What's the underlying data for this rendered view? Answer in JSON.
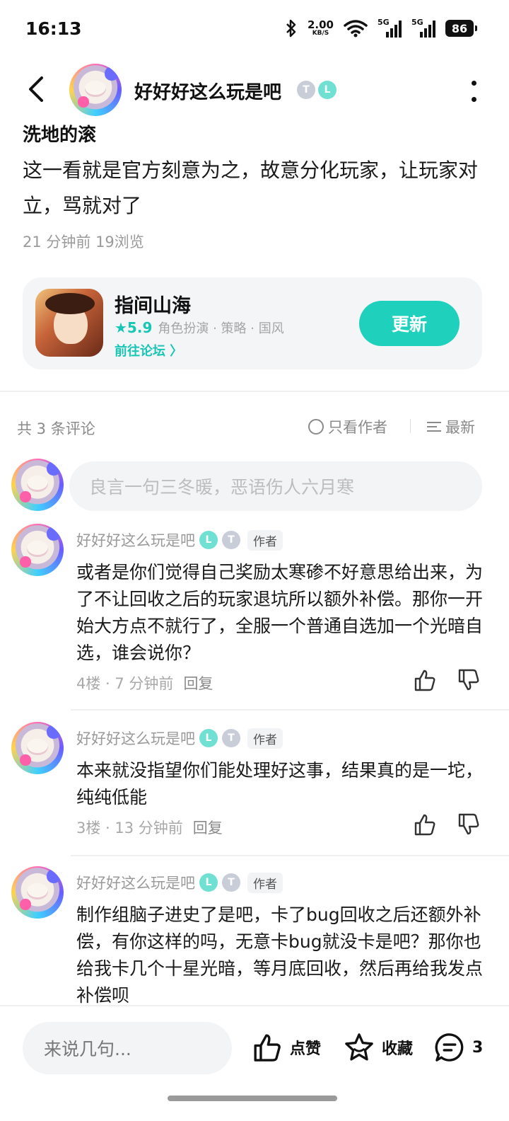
{
  "status_bar": {
    "time": "16:13",
    "net_speed_value": "2.00",
    "net_speed_unit": "KB/S",
    "signal_1": "5G",
    "signal_2": "5G",
    "battery": "86"
  },
  "header": {
    "username": "好好好这么玩是吧",
    "badges": [
      "T",
      "L"
    ]
  },
  "post": {
    "title": "洗地的滚",
    "body": "这一看就是官方刻意为之，故意分化玩家，让玩家对立，骂就对了",
    "meta": "21 分钟前  19浏览"
  },
  "game_card": {
    "name": "指间山海",
    "score": "★5.9",
    "tags": "角色扮演 · 策略 · 国风",
    "forum_link": "前往论坛 〉",
    "update_label": "更新"
  },
  "comments_bar": {
    "count": "共 3 条评论",
    "only_author": "只看作者",
    "sort": "最新",
    "input_placeholder": "良言一句三冬暖，恶语伤人六月寒"
  },
  "comments": [
    {
      "name": "好好好这么玩是吧",
      "tag": "作者",
      "text": "或者是你们觉得自己奖励太寒碜不好意思给出来，为了不让回收之后的玩家退坑所以额外补偿。那你一开始大方点不就行了，全服一个普通自选加一个光暗自选，谁会说你？",
      "meta": "4楼 · 7 分钟前",
      "reply": "回复"
    },
    {
      "name": "好好好这么玩是吧",
      "tag": "作者",
      "text": "本来就没指望你们能处理好这事，结果真的是一坨，纯纯低能",
      "meta": "3楼 · 13 分钟前",
      "reply": "回复"
    },
    {
      "name": "好好好这么玩是吧",
      "tag": "作者",
      "text": "制作组脑子进史了是吧，卡了bug回收之后还额外补偿，有你这样的吗，无意卡bug就没卡是吧？那你也给我卡几个十星光暗，等月底回收，然后再给我发点补偿呗",
      "meta": "",
      "reply": ""
    }
  ],
  "bottom_bar": {
    "input_placeholder": "来说几句...",
    "like_label": "点赞",
    "collect_label": "收藏",
    "comment_count": "3"
  },
  "colors": {
    "accent": "#1fd1bd",
    "text": "#1a1a1a",
    "muted": "#9a9a9a"
  }
}
